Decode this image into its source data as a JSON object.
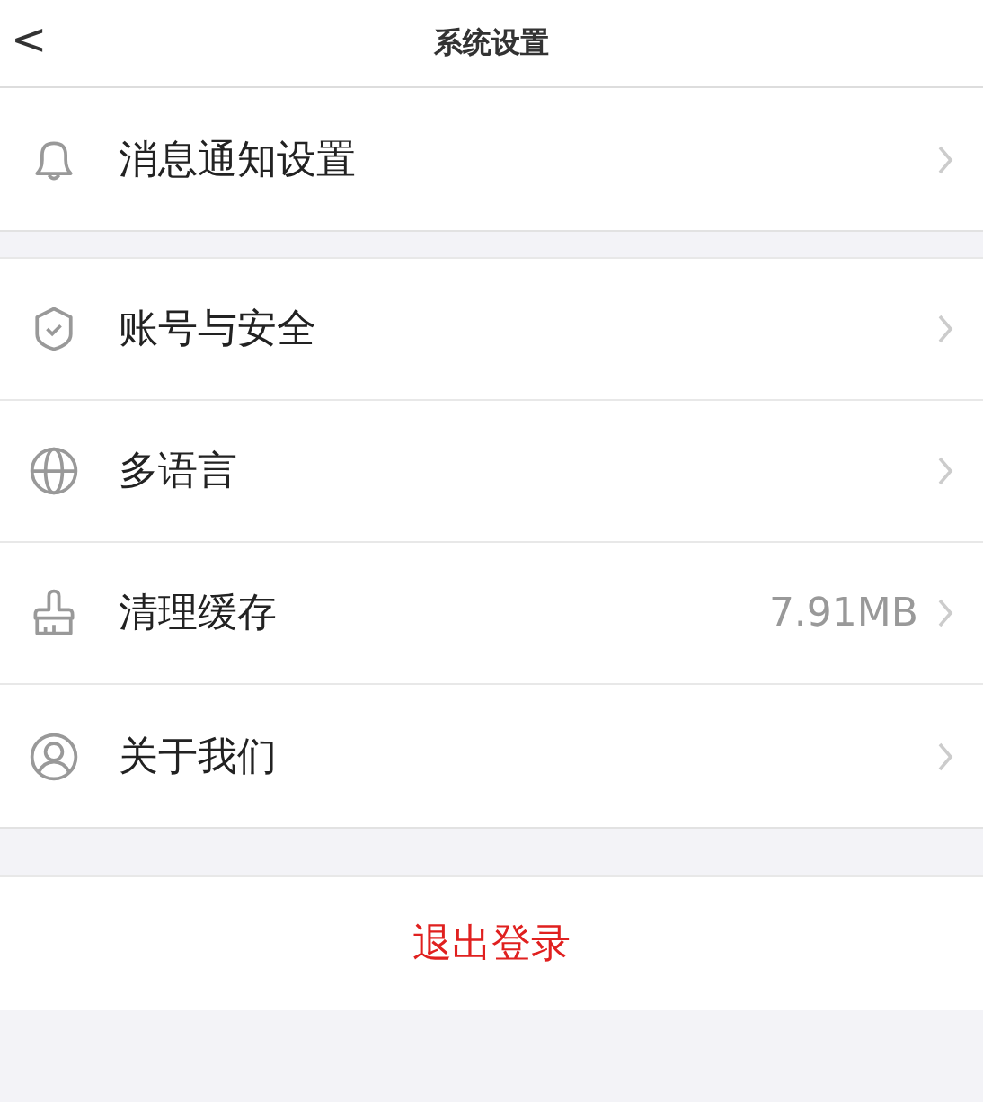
{
  "header": {
    "back": "<",
    "title": "系统设置"
  },
  "groups": [
    {
      "rows": [
        {
          "label": "消息通知设置"
        }
      ]
    },
    {
      "rows": [
        {
          "label": "账号与安全"
        },
        {
          "label": "多语言"
        },
        {
          "label": "清理缓存",
          "value": "7.91MB"
        },
        {
          "label": "关于我们"
        }
      ]
    }
  ],
  "logout": "退出登录"
}
